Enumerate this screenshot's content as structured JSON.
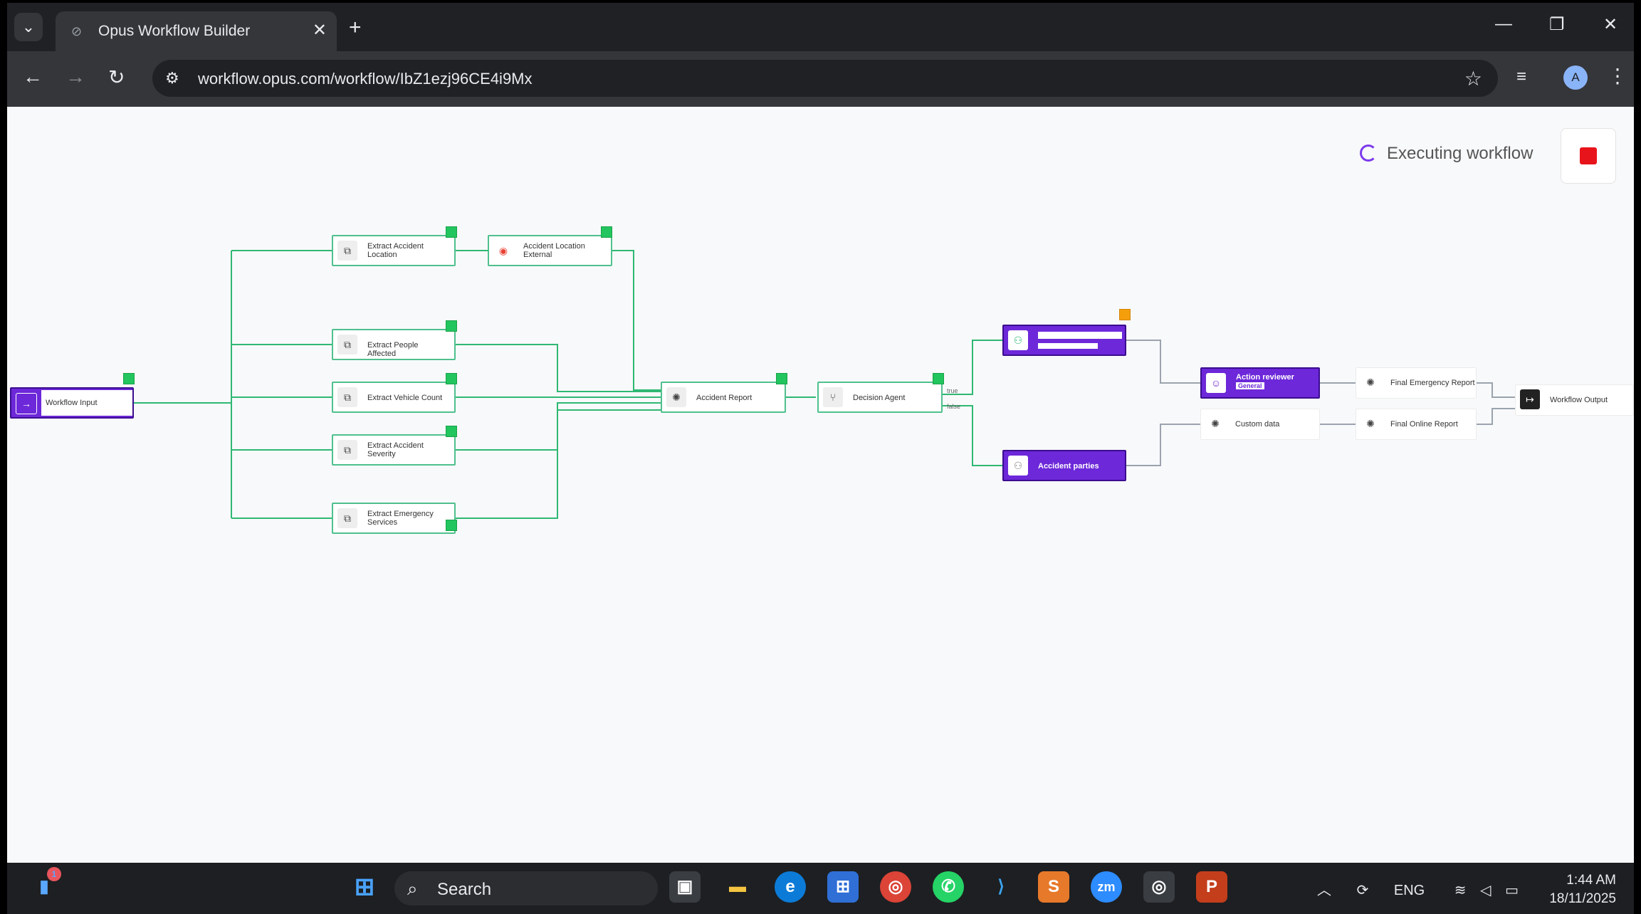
{
  "browser": {
    "tab_title": "Opus Workflow Builder",
    "url": "workflow.opus.com/workflow/IbZ1ezj96CE4i9Mx",
    "profile_initial": "A"
  },
  "page": {
    "status_text": "Executing workflow"
  },
  "nodes": {
    "workflow_input": "Workflow Input",
    "extract_location_l1": "Extract Accident",
    "extract_location_l2": "Location",
    "location_external_l1": "Accident Location",
    "location_external_l2": "External",
    "extract_people": "Extract People Affected",
    "extract_vehicle": "Extract Vehicle Count",
    "extract_severity_l1": "Extract Accident",
    "extract_severity_l2": "Severity",
    "extract_emergency_l1": "Extract Emergency",
    "extract_emergency_l2": "Services",
    "accident_report": "Accident Report",
    "decision_agent": "Decision Agent",
    "edge_true": "true",
    "edge_false": "false",
    "accident_parties": "Accident parties",
    "action_reviewer": "Action reviewer",
    "action_reviewer_tag": "General",
    "custom_data": "Custom data",
    "final_emergency": "Final Emergency Report",
    "final_online": "Final Online Report",
    "workflow_output": "Workflow Output"
  },
  "taskbar": {
    "search_text": "Search",
    "notification_count": "1",
    "language": "ENG",
    "time": "1:44 AM",
    "date": "18/11/2025"
  },
  "colors": {
    "edge": "#2fb873",
    "node_success": "#22c55e",
    "node_pending": "#f59e0b",
    "purple": "#6d28d9",
    "stop": "#e8141b"
  }
}
